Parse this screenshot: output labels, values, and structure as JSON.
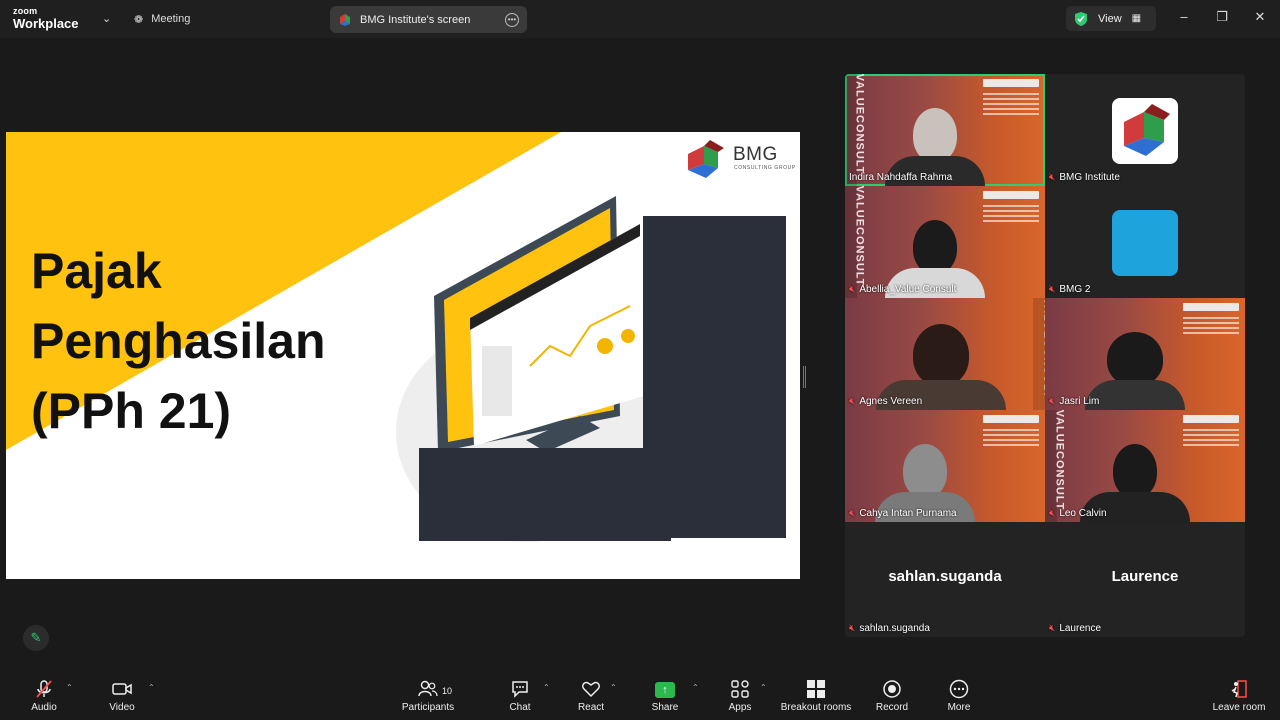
{
  "app": {
    "logo_top": "zoom",
    "logo_bottom": "Workplace"
  },
  "titlebar": {
    "meeting_label": "Meeting",
    "screen_share_label": "BMG Institute's screen",
    "view_label": "View"
  },
  "slide": {
    "title_lines": [
      "Pajak",
      "Penghasilan",
      "(PPh 21)"
    ],
    "brand": "BMG",
    "brand_sub": "CONSULTING GROUP"
  },
  "participants": [
    {
      "name": "Indira Nahdaffa Rahma",
      "type": "video",
      "speaking": true
    },
    {
      "name": "BMG Institute",
      "type": "avatar-logo"
    },
    {
      "name": "Abellia_Value Consult",
      "type": "video"
    },
    {
      "name": "BMG 2",
      "type": "avatar-color",
      "color": "#1fa3dc"
    },
    {
      "name": "Agnes Vereen",
      "type": "video"
    },
    {
      "name": "Jasri Lim",
      "type": "video"
    },
    {
      "name": "Cahya Intan Purnama",
      "type": "video"
    },
    {
      "name": "Leo Calvin",
      "type": "video"
    },
    {
      "name": "sahlan.suganda",
      "display": "sahlan.suganda",
      "type": "name-only"
    },
    {
      "name": "Laurence",
      "display": "Laurence",
      "type": "name-only"
    }
  ],
  "tile_watermark": "VALUECONSULT",
  "toolbar": {
    "audio": "Audio",
    "video": "Video",
    "participants": "Participants",
    "participants_count": "10",
    "chat": "Chat",
    "react": "React",
    "share": "Share",
    "apps": "Apps",
    "breakout": "Breakout rooms",
    "record": "Record",
    "more": "More",
    "leave": "Leave room"
  },
  "colors": {
    "accent_green": "#2ecc71",
    "slide_yellow": "#ffc20e",
    "mute_red": "#ff4d4d",
    "share_green": "#2db84d"
  }
}
